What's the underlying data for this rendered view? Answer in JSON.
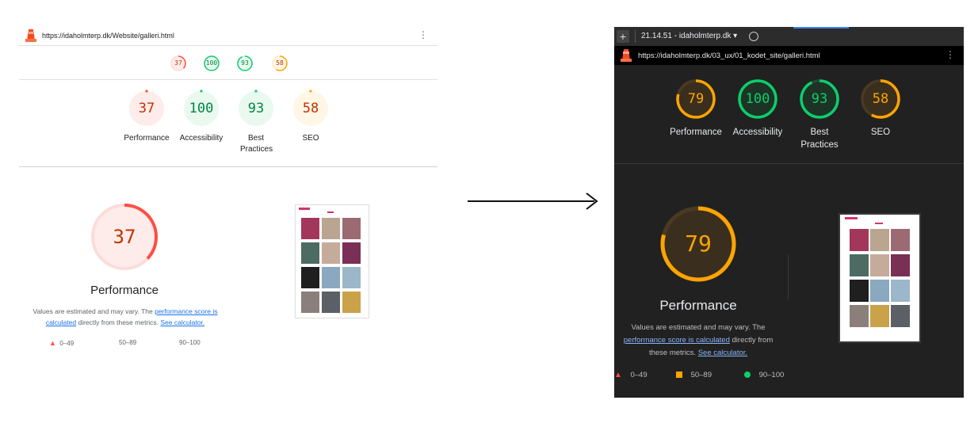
{
  "left_report": {
    "url": "https://idaholmterp.dk/Website/galleri.html",
    "menu_icon": "kebab-icon",
    "mini_scores": [
      "37",
      "100",
      "93",
      "58"
    ],
    "categories": [
      {
        "label": "Performance",
        "score": "37",
        "status": "fail"
      },
      {
        "label": "Accessibility",
        "score": "100",
        "status": "pass"
      },
      {
        "label": "Best Practices",
        "score": "93",
        "status": "pass"
      },
      {
        "label": "SEO",
        "score": "58",
        "status": "average"
      }
    ],
    "big_score": "37",
    "big_title": "Performance",
    "desc_prefix": "Values are estimated and may vary. The ",
    "desc_link1": "performance score is calculated",
    "desc_middle": " directly from these metrics. ",
    "desc_link2": "See calculator.",
    "legend": [
      "0–49",
      "50–89",
      "90–100"
    ]
  },
  "right_report": {
    "tab_title": "21.14.51 - idaholmterp.dk ▾",
    "url": "https://idaholmterp.dk/03_ux/01_kodet_site/galleri.html",
    "categories": [
      {
        "label": "Performance",
        "score": "79",
        "status": "average"
      },
      {
        "label": "Accessibility",
        "score": "100",
        "status": "pass"
      },
      {
        "label": "Best Practices",
        "score": "93",
        "status": "pass"
      },
      {
        "label": "SEO",
        "score": "58",
        "status": "average"
      }
    ],
    "big_score": "79",
    "big_title": "Performance",
    "desc_prefix": "Values are estimated and may vary. The ",
    "desc_link1": "performance score is calculated",
    "desc_middle": " directly from these metrics. ",
    "desc_link2": "See calculator.",
    "legend": [
      "0–49",
      "50–89",
      "90–100"
    ]
  },
  "colors": {
    "fail": "#ff4e42",
    "average": "#ffa400",
    "pass": "#0cce6b"
  }
}
